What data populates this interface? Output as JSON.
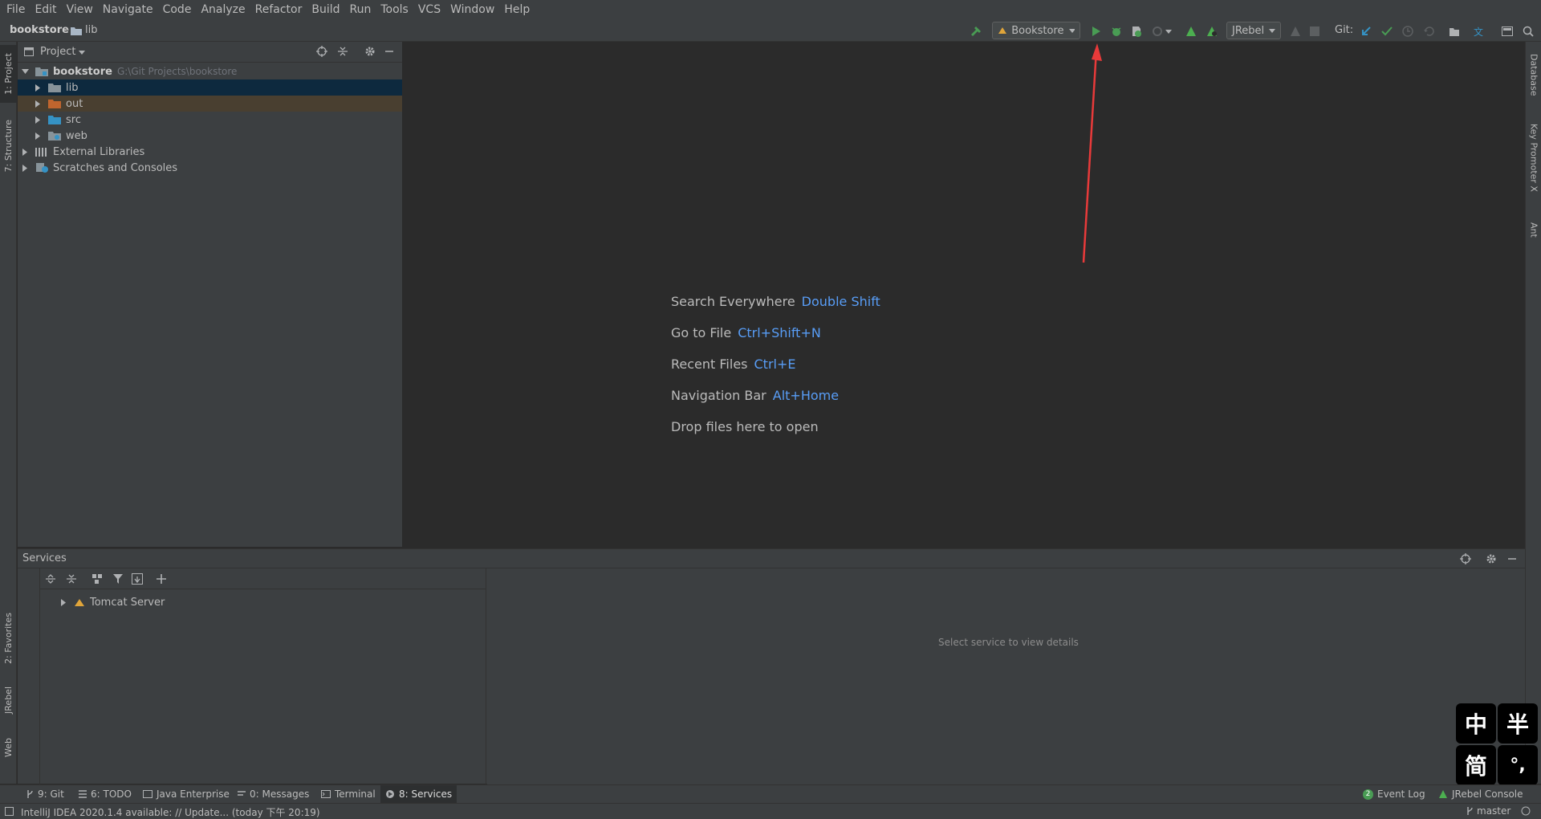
{
  "menu": [
    "File",
    "Edit",
    "View",
    "Navigate",
    "Code",
    "Analyze",
    "Refactor",
    "Build",
    "Run",
    "Tools",
    "VCS",
    "Window",
    "Help"
  ],
  "breadcrumb": {
    "project": "bookstore",
    "folder": "lib"
  },
  "toolbar": {
    "run_config": "Bookstore",
    "jrebel_config": "JRebel",
    "git_label": "Git:"
  },
  "left_tabs": {
    "project": "1: Project",
    "structure": "7: Structure",
    "favorites": "2: Favorites",
    "jrebel": "JRebel",
    "web": "Web"
  },
  "right_tabs": {
    "database": "Database",
    "key_promoter": "Key Promoter X",
    "ant": "Ant"
  },
  "project_panel": {
    "title": "Project",
    "root": {
      "name": "bookstore",
      "path": "G:\\Git Projects\\bookstore"
    },
    "children": [
      "lib",
      "out",
      "src",
      "web"
    ],
    "external": "External Libraries",
    "scratches": "Scratches and Consoles"
  },
  "editor_hints": [
    {
      "label": "Search Everywhere",
      "key": "Double Shift"
    },
    {
      "label": "Go to File",
      "key": "Ctrl+Shift+N"
    },
    {
      "label": "Recent Files",
      "key": "Ctrl+E"
    },
    {
      "label": "Navigation Bar",
      "key": "Alt+Home"
    },
    {
      "label": "Drop files here to open",
      "key": ""
    }
  ],
  "services": {
    "title": "Services",
    "tree_item": "Tomcat Server",
    "empty_text": "Select service to view details"
  },
  "bottom_tabs": {
    "git": "9: Git",
    "todo": "6: TODO",
    "java_enterprise": "Java Enterprise",
    "messages": "0: Messages",
    "terminal": "Terminal",
    "services": "8: Services",
    "event_log": "Event Log",
    "event_count": "2",
    "jrebel_console": "JRebel Console"
  },
  "status": {
    "message": "IntelliJ IDEA 2020.1.4 available: // Update... (today 下午 20:19)",
    "branch": "master"
  },
  "ime": {
    "lang": "中",
    "width": "半",
    "script": "简",
    "punct": "°,"
  },
  "colors": {
    "accent_blue": "#589df6",
    "run_green": "#499c54",
    "arrow_red": "#e83a3a",
    "selection": "#0d293e",
    "excluded": "#493f30"
  }
}
